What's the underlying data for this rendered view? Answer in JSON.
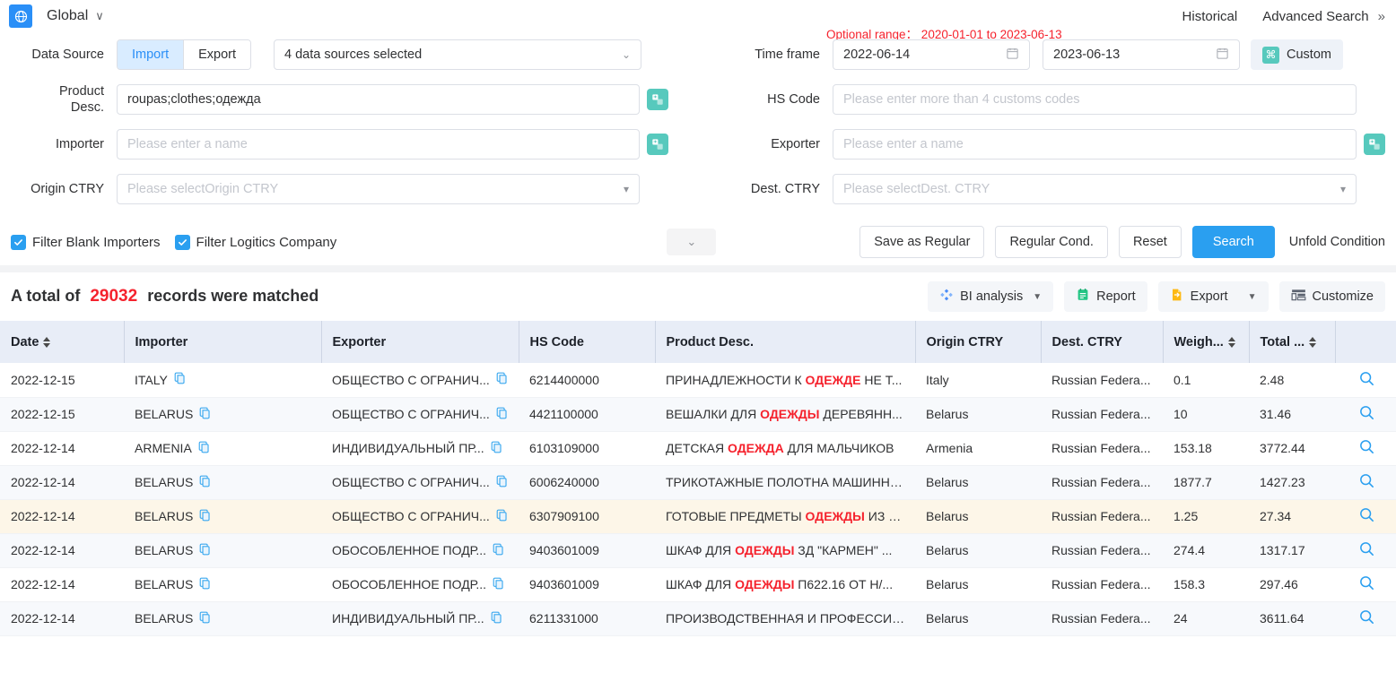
{
  "topbar": {
    "region_label": "Global",
    "region_icon": "globe-icon",
    "chevron": "∨",
    "historical": "Historical",
    "advanced_search": "Advanced Search",
    "advanced_search_chevron": "»"
  },
  "search_form": {
    "data_source_label": "Data Source",
    "import_tab": "Import",
    "export_tab": "Export",
    "data_sources_value": "4 data sources selected",
    "product_desc_label_line1": "Product",
    "product_desc_label_line2": "Desc.",
    "product_desc_value": "roupas;clothes;одежда",
    "importer_label": "Importer",
    "importer_placeholder": "Please enter a name",
    "origin_ctry_label": "Origin CTRY",
    "origin_ctry_placeholder": "Please selectOrigin CTRY",
    "time_frame_label": "Time frame",
    "optional_range": "Optional range： 2020-01-01 to 2023-06-13",
    "date_from": "2022-06-14",
    "date_to": "2023-06-13",
    "custom_button": "Custom",
    "custom_badge": "⌘",
    "hs_code_label": "HS Code",
    "hs_code_placeholder": "Please enter more than 4 customs codes",
    "exporter_label": "Exporter",
    "exporter_placeholder": "Please enter a name",
    "dest_ctry_label": "Dest. CTRY",
    "dest_ctry_placeholder": "Please selectDest. CTRY"
  },
  "filters": {
    "filter_blank_importers": "Filter Blank Importers",
    "filter_logistics_company": "Filter Logitics Company",
    "collapse_icon": "chevron-down-icon"
  },
  "action_buttons": {
    "save_as_regular": "Save as Regular",
    "regular_cond": "Regular Cond.",
    "reset": "Reset",
    "search": "Search",
    "unfold_condition": "Unfold Condition"
  },
  "results": {
    "total_prefix": "A total of",
    "total_count": "29032",
    "total_suffix": "records were matched",
    "tools": {
      "bi_analysis": "BI analysis",
      "report": "Report",
      "export": "Export",
      "customize": "Customize"
    }
  },
  "table": {
    "columns": [
      {
        "label": "Date",
        "sortable": true
      },
      {
        "label": "Importer",
        "sortable": false
      },
      {
        "label": "Exporter",
        "sortable": false
      },
      {
        "label": "HS Code",
        "sortable": false
      },
      {
        "label": "Product Desc.",
        "sortable": false
      },
      {
        "label": "Origin CTRY",
        "sortable": false
      },
      {
        "label": "Dest. CTRY",
        "sortable": false
      },
      {
        "label": "Weigh...",
        "sortable": true
      },
      {
        "label": "Total ...",
        "sortable": true
      },
      {
        "label": "",
        "sortable": false
      }
    ],
    "rows": [
      {
        "date": "2022-12-15",
        "importer": "ITALY",
        "exporter": "ОБЩЕСТВО С ОГРАНИЧ...",
        "hs_code": "6214400000",
        "product_pre": "ПРИНАДЛЕЖНОСТИ К ",
        "product_kw": "ОДЕЖДЕ",
        "product_post": " НЕ Т...",
        "origin": "Italy",
        "dest": "Russian Federa...",
        "weight": "0.1",
        "total": "2.48",
        "stripe": "odd"
      },
      {
        "date": "2022-12-15",
        "importer": "BELARUS",
        "exporter": "ОБЩЕСТВО С ОГРАНИЧ...",
        "hs_code": "4421100000",
        "product_pre": "ВЕШАЛКИ ДЛЯ ",
        "product_kw": "ОДЕЖДЫ",
        "product_post": " ДЕРЕВЯНН...",
        "origin": "Belarus",
        "dest": "Russian Federa...",
        "weight": "10",
        "total": "31.46",
        "stripe": "even"
      },
      {
        "date": "2022-12-14",
        "importer": "ARMENIA",
        "exporter": "ИНДИВИДУАЛЬНЫЙ ПР...",
        "hs_code": "6103109000",
        "product_pre": "ДЕТСКАЯ ",
        "product_kw": "ОДЕЖДА",
        "product_post": " ДЛЯ МАЛЬЧИКОВ",
        "origin": "Armenia",
        "dest": "Russian Federa...",
        "weight": "153.18",
        "total": "3772.44",
        "stripe": "odd"
      },
      {
        "date": "2022-12-14",
        "importer": "BELARUS",
        "exporter": "ОБЩЕСТВО С ОГРАНИЧ...",
        "hs_code": "6006240000",
        "product_pre": "ТРИКОТАЖНЫЕ ПОЛОТНА МАШИННО...",
        "product_kw": "",
        "product_post": "",
        "origin": "Belarus",
        "dest": "Russian Federa...",
        "weight": "1877.7",
        "total": "1427.23",
        "stripe": "even"
      },
      {
        "date": "2022-12-14",
        "importer": "BELARUS",
        "exporter": "ОБЩЕСТВО С ОГРАНИЧ...",
        "hs_code": "6307909100",
        "product_pre": "ГОТОВЫЕ ПРЕДМЕТЫ ",
        "product_kw": "ОДЕЖДЫ",
        "product_post": " ИЗ В...",
        "origin": "Belarus",
        "dest": "Russian Federa...",
        "weight": "1.25",
        "total": "27.34",
        "stripe": "hl"
      },
      {
        "date": "2022-12-14",
        "importer": "BELARUS",
        "exporter": "ОБОСОБЛЕННОЕ ПОДР...",
        "hs_code": "9403601009",
        "product_pre": "ШКАФ ДЛЯ ",
        "product_kw": "ОДЕЖДЫ",
        "product_post": " ЗД \"КАРМЕН\" ...",
        "origin": "Belarus",
        "dest": "Russian Federa...",
        "weight": "274.4",
        "total": "1317.17",
        "stripe": "even"
      },
      {
        "date": "2022-12-14",
        "importer": "BELARUS",
        "exporter": "ОБОСОБЛЕННОЕ ПОДР...",
        "hs_code": "9403601009",
        "product_pre": "ШКАФ ДЛЯ ",
        "product_kw": "ОДЕЖДЫ",
        "product_post": " П622.16 ОТ Н/...",
        "origin": "Belarus",
        "dest": "Russian Federa...",
        "weight": "158.3",
        "total": "297.46",
        "stripe": "odd"
      },
      {
        "date": "2022-12-14",
        "importer": "BELARUS",
        "exporter": "ИНДИВИДУАЛЬНЫЙ ПР...",
        "hs_code": "6211331000",
        "product_pre": "ПРОИЗВОДСТВЕННАЯ И ПРОФЕССИО...",
        "product_kw": "",
        "product_post": "",
        "origin": "Belarus",
        "dest": "Russian Federa...",
        "weight": "24",
        "total": "3611.64",
        "stripe": "even"
      }
    ]
  },
  "colors": {
    "accent": "#2a9ff0",
    "danger": "#f5222d",
    "teal": "#57c9bd",
    "header_bg": "#e8edf7",
    "highlight_row": "#fdf6e8"
  }
}
